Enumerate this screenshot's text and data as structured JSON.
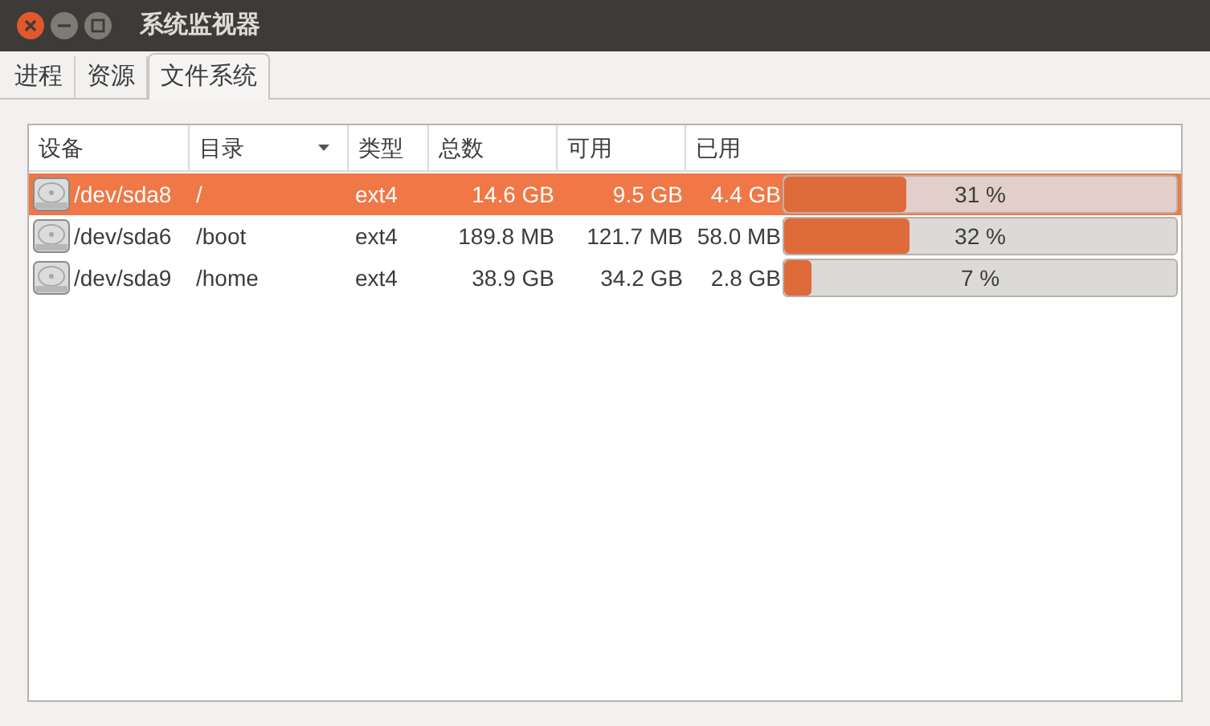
{
  "window": {
    "title": "系统监视器"
  },
  "tabs": [
    {
      "label": "进程",
      "selected": false
    },
    {
      "label": "资源",
      "selected": false
    },
    {
      "label": "文件系统",
      "selected": true
    }
  ],
  "table": {
    "columns": [
      {
        "label": "设备",
        "sorted": false
      },
      {
        "label": "目录",
        "sorted": true
      },
      {
        "label": "类型",
        "sorted": false
      },
      {
        "label": "总数",
        "sorted": false
      },
      {
        "label": "可用",
        "sorted": false
      },
      {
        "label": "已用",
        "sorted": false
      }
    ],
    "rows": [
      {
        "selected": true,
        "device": "/dev/sda8",
        "directory": "/",
        "type": "ext4",
        "total": "14.6 GB",
        "free": "9.5 GB",
        "used": "4.4 GB",
        "level": 0.31,
        "percent": "31 %"
      },
      {
        "selected": false,
        "device": "/dev/sda6",
        "directory": "/boot",
        "type": "ext4",
        "total": "189.8 MB",
        "free": "121.7 MB",
        "used": "58.0 MB",
        "level": 0.32,
        "percent": "32 %"
      },
      {
        "selected": false,
        "device": "/dev/sda9",
        "directory": "/home",
        "type": "ext4",
        "total": "38.9 GB",
        "free": "34.2 GB",
        "used": "2.8 GB",
        "level": 0.07,
        "percent": "7 %"
      }
    ]
  }
}
